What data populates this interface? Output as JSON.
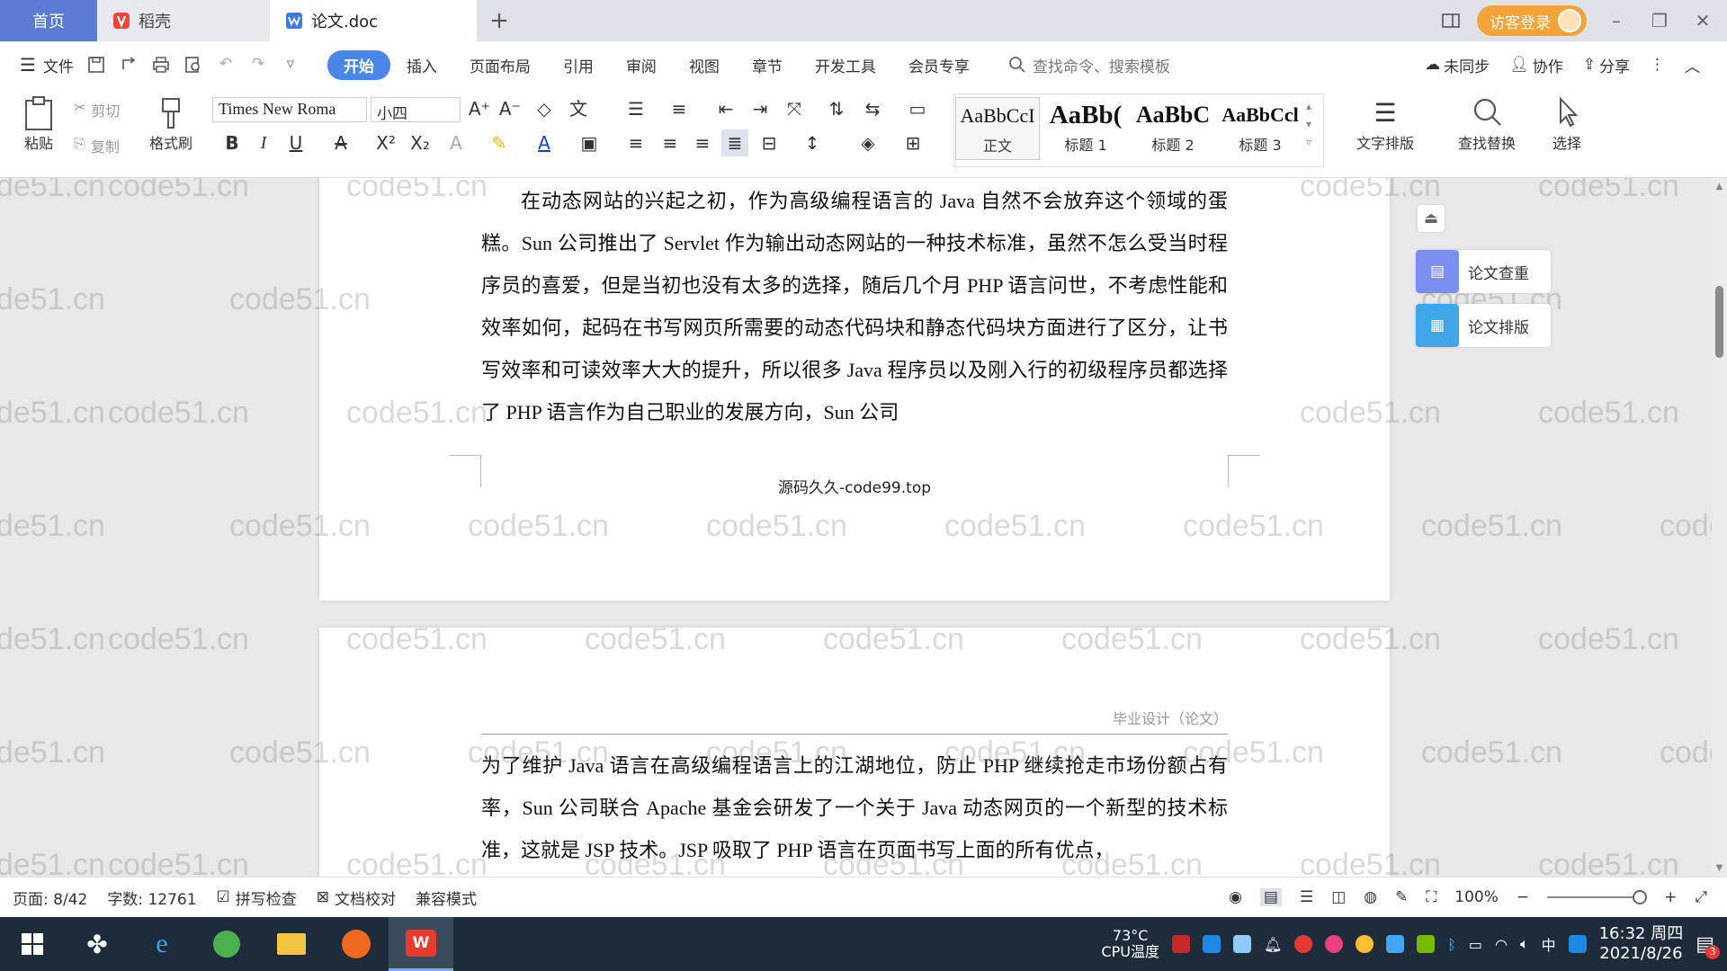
{
  "titlebar": {
    "tabs": [
      {
        "label": "首页"
      },
      {
        "label": "稻壳"
      },
      {
        "label": "论文.doc"
      }
    ],
    "visitor_label": "访客登录"
  },
  "menubar": {
    "file_label": "文件",
    "tabs": [
      "开始",
      "插入",
      "页面布局",
      "引用",
      "审阅",
      "视图",
      "章节",
      "开发工具",
      "会员专享"
    ],
    "search_placeholder": "查找命令、搜索模板",
    "sync_label": "未同步",
    "collab_label": "协作",
    "share_label": "分享"
  },
  "toolbar": {
    "paste_label": "粘贴",
    "cut_label": "剪切",
    "copy_label": "复制",
    "format_painter_label": "格式刷",
    "font_name": "Times New Roma",
    "font_size": "小四",
    "styles": [
      {
        "sample": "AaBbCcI",
        "name": "正文"
      },
      {
        "sample": "AaBb(",
        "name": "标题 1"
      },
      {
        "sample": "AaBbC",
        "name": "标题 2"
      },
      {
        "sample": "AaBbCcl",
        "name": "标题 3"
      }
    ],
    "text_layout_label": "文字排版",
    "find_replace_label": "查找替换",
    "select_label": "选择"
  },
  "document": {
    "page1": {
      "paragraph": "在动态网站的兴起之初，作为高级编程语言的 Java 自然不会放弃这个领域的蛋糕。Sun 公司推出了 Servlet 作为输出动态网站的一种技术标准，虽然不怎么受当时程序员的喜爱，但是当初也没有太多的选择，随后几个月 PHP 语言问世，不考虑性能和效率如何，起码在书写网页所需要的动态代码块和静态代码块方面进行了区分，让书写效率和可读效率大大的提升，所以很多 Java 程序员以及刚入行的初级程序员都选择了 PHP 语言作为自己职业的发展方向，Sun 公司",
      "footer": "源码久久-code99.top"
    },
    "page2": {
      "header": "毕业设计（论文）",
      "paragraph": "为了维护 Java 语言在高级编程语言上的江湖地位，防止 PHP 继续抢走市场份额占有率，Sun 公司联合 Apache 基金会研发了一个关于 Java 动态网页的一个新型的技术标准，这就是 JSP 技术。JSP 吸取了 PHP 语言在页面书写上面的所有优点，"
    },
    "watermark": "code51.cn"
  },
  "side_panel": {
    "check_label": "论文查重",
    "layout_label": "论文排版"
  },
  "statusbar": {
    "page": "页面: 8/42",
    "words": "字数: 12761",
    "spell_check": "拼写检查",
    "doc_proof": "文档校对",
    "compat_mode": "兼容模式",
    "zoom": "100%"
  },
  "taskbar": {
    "temp": "73°C",
    "temp_label": "CPU温度",
    "input_method": "中",
    "time": "16:32 周四",
    "date": "2021/8/26",
    "notification_count": "3"
  },
  "colors": {
    "accent": "#4a86e8",
    "home_tab": "#5b7bd5",
    "visitor": "#f2a43a",
    "taskbar": "#1e2b3a"
  }
}
